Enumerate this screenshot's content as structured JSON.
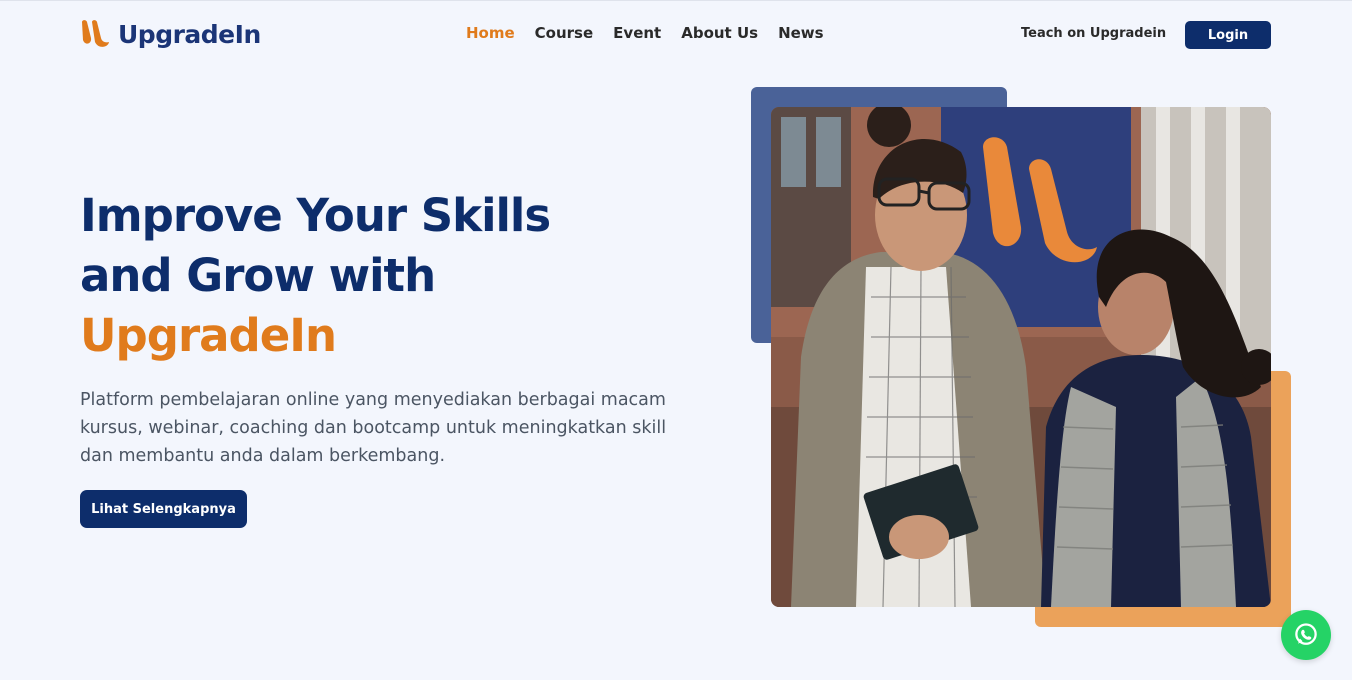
{
  "brand": {
    "name": "UpgradeIn",
    "primary_color": "#0d2d6b",
    "accent_color": "#e07b1c"
  },
  "nav": {
    "items": [
      {
        "label": "Home",
        "active": true
      },
      {
        "label": "Course",
        "active": false
      },
      {
        "label": "Event",
        "active": false
      },
      {
        "label": "About Us",
        "active": false
      },
      {
        "label": "News",
        "active": false
      }
    ],
    "teach_label": "Teach on Upgradein",
    "login_label": "Login"
  },
  "hero": {
    "title_line1": "Improve Your Skills",
    "title_line2": "and Grow with",
    "title_line3": "UpgradeIn",
    "description": "Platform pembelajaran online yang menyediakan berbagai macam kursus, webinar, coaching dan bootcamp untuk meningkatkan skill dan membantu anda dalam berkembang.",
    "cta_label": "Lihat Selengkapnya",
    "image_icon": "students-photo"
  },
  "floating": {
    "whatsapp_icon": "whatsapp-icon"
  }
}
